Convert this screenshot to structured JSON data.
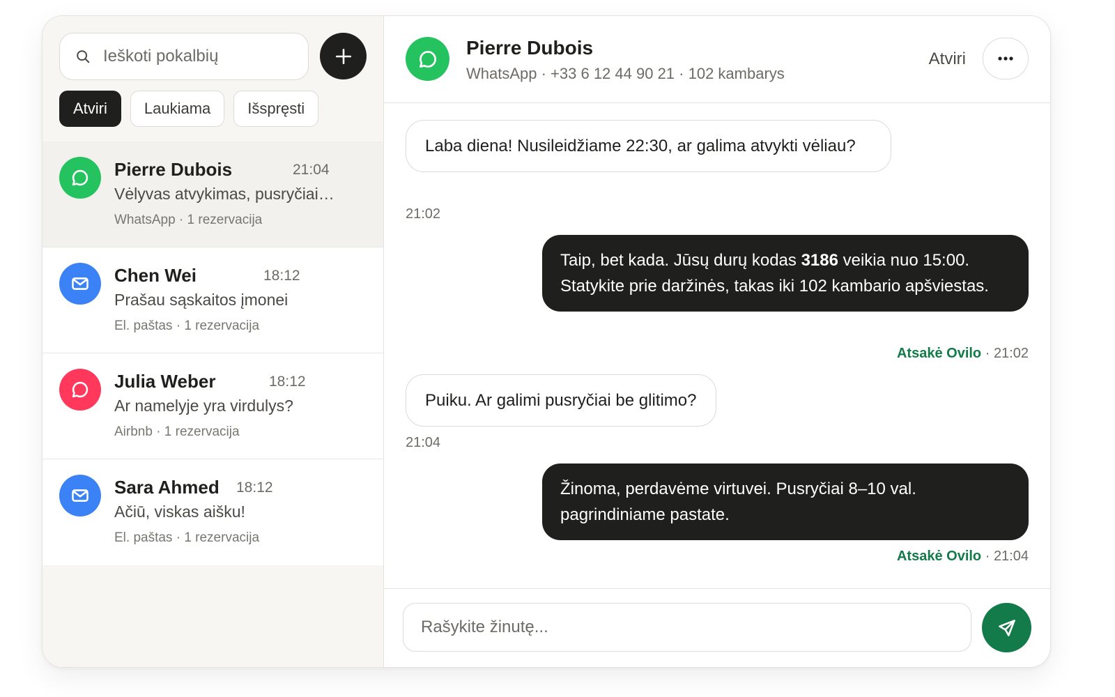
{
  "search": {
    "placeholder": "Ieškoti pokalbių"
  },
  "filters": [
    {
      "label": "Atviri",
      "active": true
    },
    {
      "label": "Laukiama",
      "active": false
    },
    {
      "label": "Išspręsti",
      "active": false
    }
  ],
  "conversations": [
    {
      "name": "Pierre Dubois",
      "time": "21:04",
      "preview": "Vėlyvas atvykimas, pusryčiai be glitimo",
      "meta": "WhatsApp · 1 rezervacija",
      "icon": "whatsapp-chat-icon",
      "color": "#25c35f",
      "selected": true
    },
    {
      "name": "Chen Wei",
      "time": "18:12",
      "preview": "Prašau sąskaitos įmonei",
      "meta": "El. paštas · 1 rezervacija",
      "icon": "mail-icon",
      "color": "#3b82f6",
      "selected": false
    },
    {
      "name": "Julia Weber",
      "time": "18:12",
      "preview": "Ar namelyje yra virdulys?",
      "meta": "Airbnb · 1 rezervacija",
      "icon": "airbnb-chat-icon",
      "color": "#ff385c",
      "selected": false
    },
    {
      "name": "Sara Ahmed",
      "time": "18:12",
      "preview": "Ačiū, viskas aišku!",
      "meta": "El. paštas · 1 rezervacija",
      "icon": "mail-icon",
      "color": "#3b82f6",
      "selected": false
    }
  ],
  "chat": {
    "contact_name": "Pierre Dubois",
    "contact_meta": "WhatsApp · +33 6 12 44 90 21 · 102 kambarys",
    "status": "Atviri",
    "messages": [
      {
        "direction": "in",
        "text": "Laba diena! Nusileidžiame 22:30, ar galima atvykti vėliau?",
        "time": "21:02"
      },
      {
        "direction": "out",
        "text_before": "Taip, bet kada. Jūsų durų kodas ",
        "code": "3186",
        "text_after": " veikia nuo 15:00. Statykite prie daržinės, takas iki 102 kambario apšviestas.",
        "agent": "Atsakė Ovilo",
        "time": "21:02"
      },
      {
        "direction": "in",
        "text": "Puiku. Ar galimi pusryčiai be glitimo?",
        "time": "21:04"
      },
      {
        "direction": "out",
        "text": "Žinoma, perdavėme virtuvei. Pusryčiai 8–10 val. pagrindiniame pastate.",
        "agent": "Atsakė Ovilo",
        "time": "21:04"
      }
    ],
    "composer_placeholder": "Rašykite žinutę..."
  },
  "colors": {
    "accent": "#137a4a",
    "whatsapp": "#25c35f",
    "email": "#3b82f6",
    "airbnb": "#ff385c",
    "dark": "#1f1f1d"
  }
}
